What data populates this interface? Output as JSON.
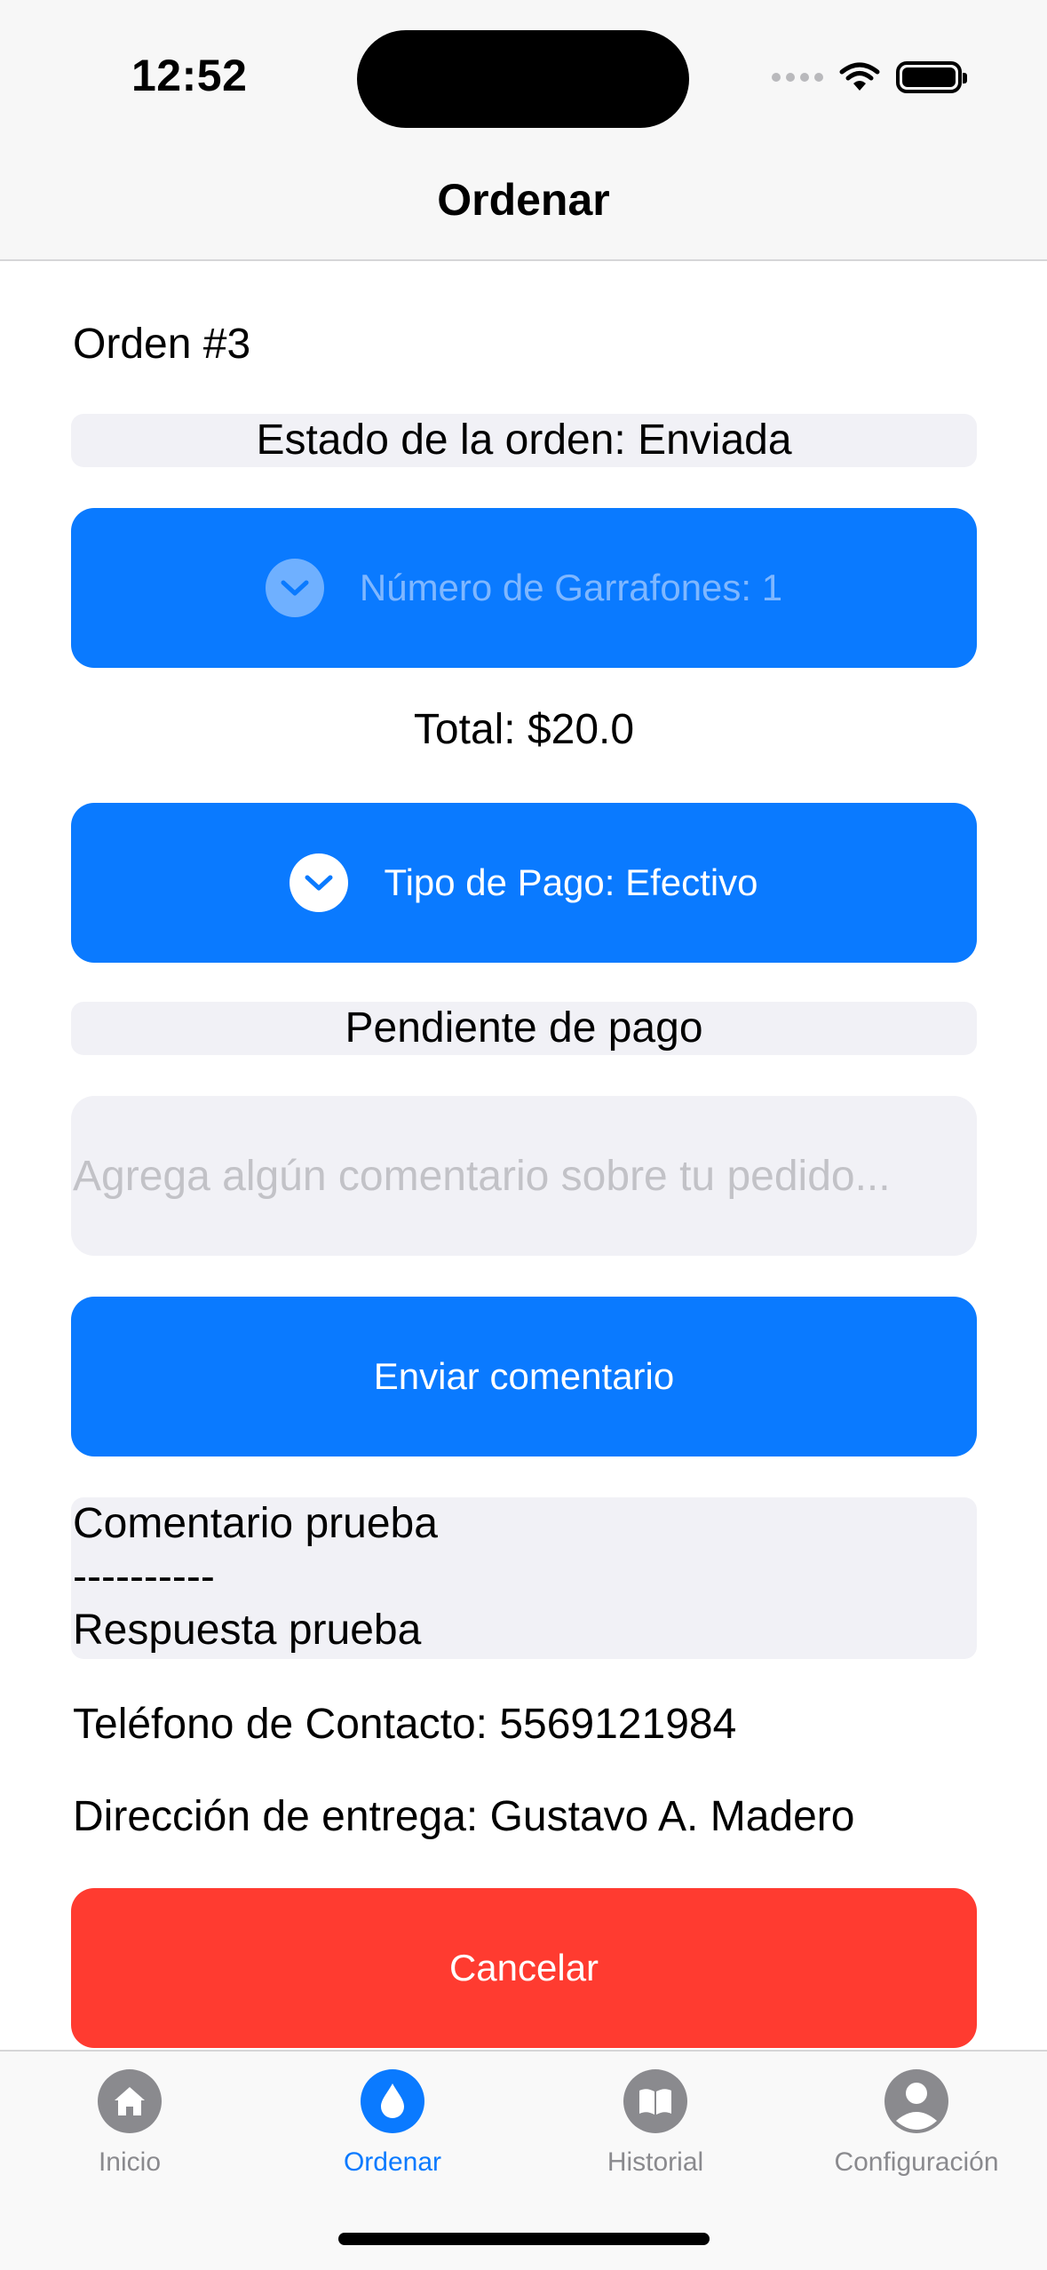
{
  "status_bar": {
    "time": "12:52"
  },
  "nav": {
    "title": "Ordenar"
  },
  "order": {
    "number_label": "Orden #3",
    "status_label": "Estado de la orden: Enviada",
    "quantity_label": "Número de Garrafones: 1",
    "total_label": "Total: $20.0",
    "payment_label": "Tipo de Pago: Efectivo",
    "payment_status": "Pendiente de pago",
    "comment_placeholder": "Agrega algún comentario sobre tu pedido...",
    "send_comment_label": "Enviar comentario",
    "comments": {
      "comment": "Comentario prueba",
      "separator": "----------",
      "reply": "Respuesta prueba"
    },
    "contact_label": "Teléfono de Contacto: 5569121984",
    "address_label": "Dirección de entrega: Gustavo A. Madero",
    "cancel_label": "Cancelar"
  },
  "tab_bar": {
    "items": [
      {
        "label": "Inicio",
        "icon": "house-icon",
        "active": false
      },
      {
        "label": "Ordenar",
        "icon": "water-drop-icon",
        "active": true
      },
      {
        "label": "Historial",
        "icon": "book-icon",
        "active": false
      },
      {
        "label": "Configuración",
        "icon": "person-icon",
        "active": false
      }
    ]
  },
  "colors": {
    "accent": "#0a7aff",
    "danger": "#ff3b30",
    "inactive_tab": "#8a8a8e",
    "light_gray_bg": "#f1f1f6"
  }
}
